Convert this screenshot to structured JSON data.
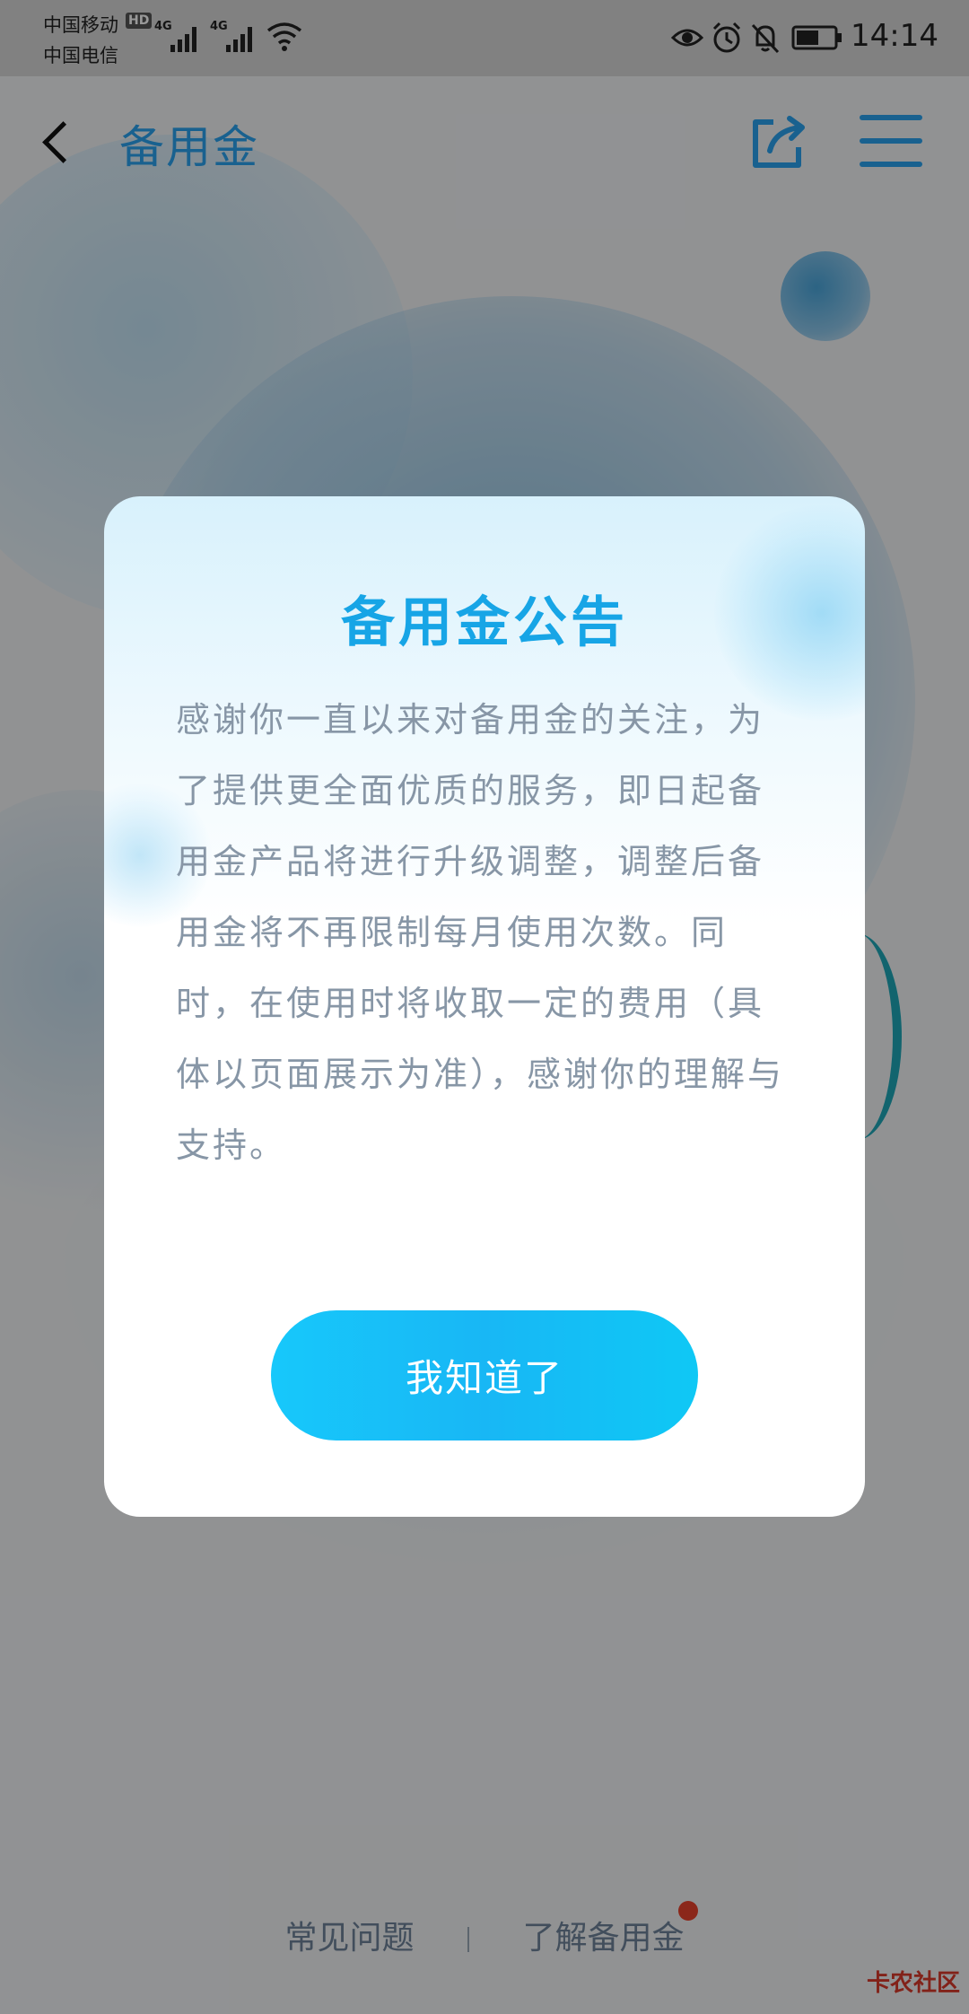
{
  "status_bar": {
    "carrier_1": "中国移动",
    "carrier_2": "中国电信",
    "hd_badge": "HD",
    "network_1": "4G",
    "network_2": "4G",
    "time": "14:14"
  },
  "nav": {
    "title": "备用金"
  },
  "dialog": {
    "title": "备用金公告",
    "body": "感谢你一直以来对备用金的关注，为了提供更全面优质的服务，即日起备用金产品将进行升级调整，调整后备用金将不再限制每月使用次数。同时，在使用时将收取一定的费用（具体以页面展示为准），感谢你的理解与支持。",
    "confirm_label": "我知道了"
  },
  "footer": {
    "faq_label": "常见问题",
    "learn_label": "了解备用金"
  },
  "watermark": "卡农社区",
  "colors": {
    "accent": "#2aa2ee",
    "dialog_title": "#17a5e6",
    "button": "#17c0f8",
    "notification_dot": "#e8412c"
  }
}
